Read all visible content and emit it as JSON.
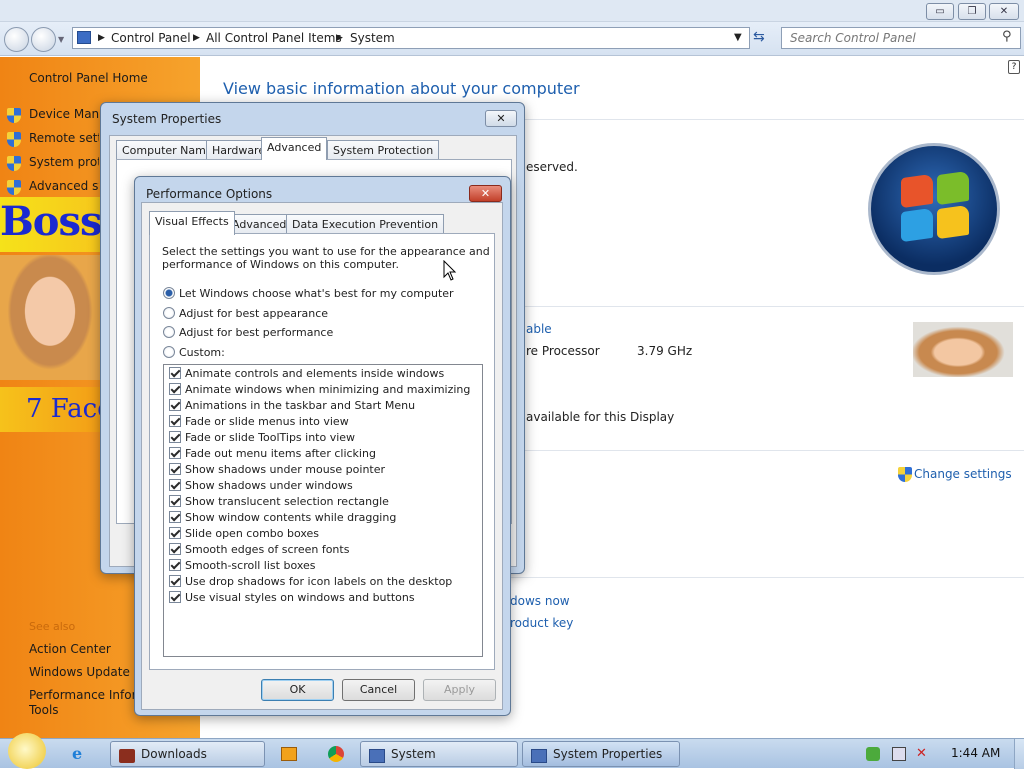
{
  "window": {
    "minimize": "▭",
    "restore": "❐",
    "close": "✕"
  },
  "address_bar": {
    "crumbs": [
      "Control Panel",
      "All Control Panel Items",
      "System"
    ],
    "search_placeholder": "Search Control Panel"
  },
  "left_pane": {
    "home": "Control Panel Home",
    "links": [
      "Device Manag",
      "Remote settin",
      "System prote",
      "Advanced sys"
    ],
    "banner_text": "BossK",
    "banner_text2": "7 Face",
    "see_also": "See also",
    "see_also_links": [
      "Action Center",
      "Windows Update",
      "Performance Inform",
      "Tools"
    ]
  },
  "main": {
    "heading": "View basic information about your computer",
    "reserved": "eserved.",
    "rating_link": "able",
    "processor_label": "re Processor",
    "processor_speed": "3.79 GHz",
    "display_text": "available for this Display",
    "change_settings": "Change settings",
    "activate_link": "dows now",
    "product_key_link": "roduct key"
  },
  "system_properties": {
    "title": "System Properties",
    "tabs": [
      "Computer Name",
      "Hardware",
      "Advanced",
      "System Protection"
    ]
  },
  "performance_options": {
    "title": "Performance Options",
    "tabs": [
      "Visual Effects",
      "Advanced",
      "Data Execution Prevention"
    ],
    "description_1": "Select the settings you want to use for the appearance and",
    "description_2": "performance of Windows on this computer.",
    "radios": [
      {
        "label": "Let Windows choose what's best for my computer",
        "selected": true
      },
      {
        "label": "Adjust for best appearance",
        "selected": false
      },
      {
        "label": "Adjust for best performance",
        "selected": false
      },
      {
        "label": "Custom:",
        "selected": false
      }
    ],
    "effects": [
      "Animate controls and elements inside windows",
      "Animate windows when minimizing and maximizing",
      "Animations in the taskbar and Start Menu",
      "Fade or slide menus into view",
      "Fade or slide ToolTips into view",
      "Fade out menu items after clicking",
      "Show shadows under mouse pointer",
      "Show shadows under windows",
      "Show translucent selection rectangle",
      "Show window contents while dragging",
      "Slide open combo boxes",
      "Smooth edges of screen fonts",
      "Smooth-scroll list boxes",
      "Use drop shadows for icon labels on the desktop",
      "Use visual styles on windows and buttons"
    ],
    "ok": "OK",
    "cancel": "Cancel",
    "apply": "Apply"
  },
  "taskbar": {
    "items": [
      "Downloads",
      "System",
      "System Properties"
    ],
    "clock": "1:44 AM"
  },
  "colors": {
    "left_pane_orange": "#f08414",
    "link_blue": "#1e5fae",
    "dialog_frame": "#c4d6ec",
    "taskbar": "#b9cce4"
  }
}
